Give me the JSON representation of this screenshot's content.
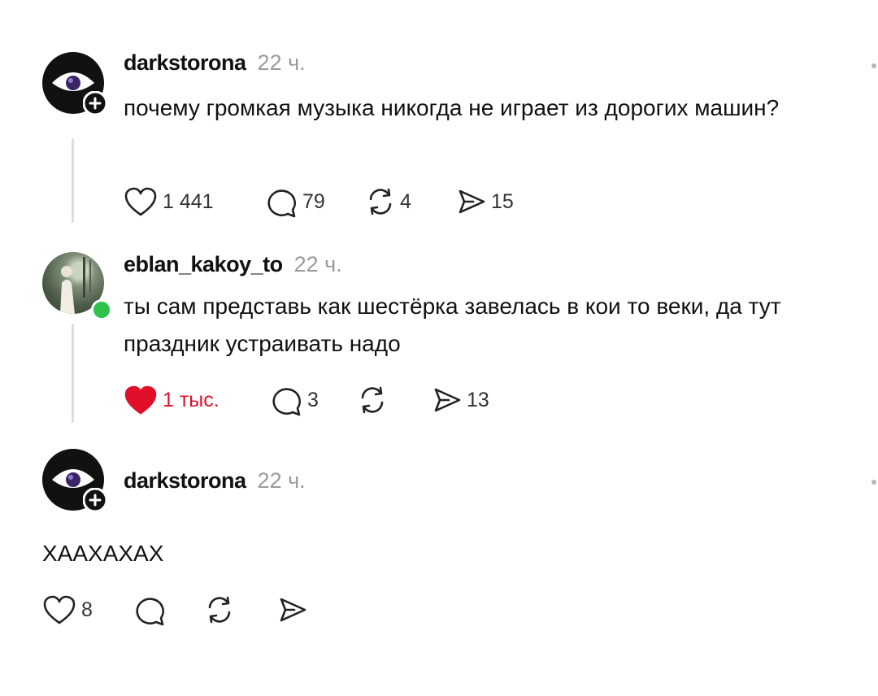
{
  "posts": [
    {
      "username": "darkstorona",
      "time": "22 ч.",
      "text": "почему громкая музыка никогда не играет из дорогих машин?",
      "likes": "1 441",
      "liked": false,
      "replies": "79",
      "reposts": "4",
      "shares": "15"
    },
    {
      "username": "eblan_kakoy_to",
      "time": "22 ч.",
      "text": "ты сам представь как шестёрка завелась в кои то веки, да тут праздник устраивать надо",
      "likes": "1 тыс.",
      "liked": true,
      "replies": "3",
      "reposts": "",
      "shares": "13"
    },
    {
      "username": "darkstorona",
      "time": "22 ч.",
      "text": "ХААХАХАХ",
      "likes": "8",
      "liked": false,
      "replies": "",
      "reposts": "",
      "shares": ""
    }
  ],
  "colors": {
    "like_active": "#e0102a",
    "online": "#2fc24a",
    "muted": "#9a9a9a"
  },
  "icons": [
    "heart-icon",
    "comment-icon",
    "repost-icon",
    "share-icon",
    "plus-icon",
    "more-icon"
  ]
}
